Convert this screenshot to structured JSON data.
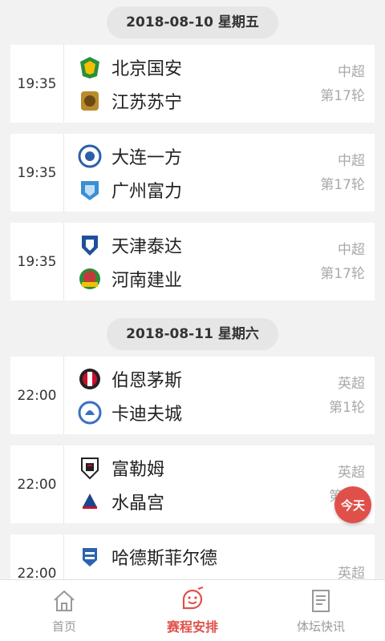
{
  "sections": [
    {
      "date": "2018-08-10 星期五",
      "matches": [
        {
          "time": "19:35",
          "home": "北京国安",
          "away": "江苏苏宁",
          "league": "中超",
          "round": "第17轮",
          "home_color": "#2a8f3c",
          "away_color": "#b88b2d"
        },
        {
          "time": "19:35",
          "home": "大连一方",
          "away": "广州富力",
          "league": "中超",
          "round": "第17轮",
          "home_color": "#2d5fa8",
          "away_color": "#3b8fd4"
        },
        {
          "time": "19:35",
          "home": "天津泰达",
          "away": "河南建业",
          "league": "中超",
          "round": "第17轮",
          "home_color": "#1f4f9c",
          "away_color": "#c23b3b"
        }
      ]
    },
    {
      "date": "2018-08-11 星期六",
      "matches": [
        {
          "time": "22:00",
          "home": "伯恩茅斯",
          "away": "卡迪夫城",
          "league": "英超",
          "round": "第1轮",
          "home_color": "#c8102e",
          "away_color": "#3a6fc4"
        },
        {
          "time": "22:00",
          "home": "富勒姆",
          "away": "水晶宫",
          "league": "英超",
          "round": "第1轮",
          "home_color": "#222222",
          "away_color": "#1b458f"
        },
        {
          "time": "22:00",
          "home": "哈德斯菲尔德",
          "away": "",
          "league": "英超",
          "round": "",
          "home_color": "#2a64b0",
          "away_color": "#cccccc"
        }
      ]
    }
  ],
  "today_button": "今天",
  "tabs": [
    {
      "label": "首页",
      "icon": "home-icon"
    },
    {
      "label": "赛程安排",
      "icon": "schedule-face-icon"
    },
    {
      "label": "体坛快讯",
      "icon": "news-icon"
    }
  ],
  "colors": {
    "accent": "#e0504a",
    "inactive": "#999999"
  }
}
